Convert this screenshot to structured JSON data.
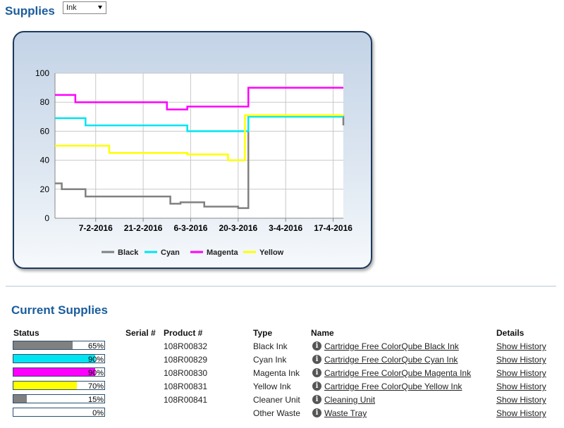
{
  "header": {
    "title": "Supplies",
    "selector_value": "Ink"
  },
  "chart_data": {
    "type": "line",
    "ylim": [
      0,
      100
    ],
    "yticks": [
      0,
      20,
      40,
      60,
      80,
      100
    ],
    "xlim": [
      "2016-01-26",
      "2016-04-20"
    ],
    "xticks": [
      "7-2-2016",
      "21-2-2016",
      "6-3-2016",
      "20-3-2016",
      "3-4-2016",
      "17-4-2016"
    ],
    "xtick_dates": [
      "2016-02-07",
      "2016-02-21",
      "2016-03-06",
      "2016-03-20",
      "2016-04-03",
      "2016-04-17"
    ],
    "grid": true,
    "legend_position": "bottom",
    "series": [
      {
        "name": "Black",
        "color": "#808080",
        "step_points": [
          [
            "2016-01-26",
            24
          ],
          [
            "2016-01-28",
            20
          ],
          [
            "2016-02-04",
            15
          ],
          [
            "2016-02-29",
            10
          ],
          [
            "2016-03-03",
            11
          ],
          [
            "2016-03-10",
            8
          ],
          [
            "2016-03-20",
            7
          ],
          [
            "2016-03-23",
            70
          ],
          [
            "2016-04-19",
            70
          ],
          [
            "2016-04-20",
            64
          ]
        ]
      },
      {
        "name": "Cyan",
        "color": "#00e5f2",
        "step_points": [
          [
            "2016-01-26",
            69
          ],
          [
            "2016-02-04",
            64
          ],
          [
            "2016-03-05",
            60
          ],
          [
            "2016-03-23",
            70
          ],
          [
            "2016-04-20",
            70
          ]
        ]
      },
      {
        "name": "Magenta",
        "color": "#ff00ff",
        "step_points": [
          [
            "2016-01-26",
            85
          ],
          [
            "2016-02-01",
            80
          ],
          [
            "2016-02-28",
            75
          ],
          [
            "2016-03-05",
            77
          ],
          [
            "2016-03-23",
            90
          ],
          [
            "2016-04-20",
            90
          ]
        ]
      },
      {
        "name": "Yellow",
        "color": "#ffff00",
        "step_points": [
          [
            "2016-01-26",
            50
          ],
          [
            "2016-02-11",
            45
          ],
          [
            "2016-03-05",
            44
          ],
          [
            "2016-03-17",
            40
          ],
          [
            "2016-03-22",
            71
          ],
          [
            "2016-04-20",
            71
          ]
        ]
      }
    ]
  },
  "current": {
    "title": "Current Supplies",
    "headers": {
      "status": "Status",
      "serial": "Serial #",
      "product": "Product #",
      "type": "Type",
      "name": "Name",
      "details": "Details"
    },
    "rows": [
      {
        "pct": "65%",
        "value": 65,
        "color": "#808080",
        "product": "108R00832",
        "type": "Black Ink",
        "name": "Cartridge Free ColorQube Black Ink",
        "details": "Show History"
      },
      {
        "pct": "90%",
        "value": 90,
        "color": "#00e5f2",
        "product": "108R00829",
        "type": "Cyan Ink",
        "name": "Cartridge Free ColorQube Cyan Ink",
        "details": "Show History"
      },
      {
        "pct": "90%",
        "value": 90,
        "color": "#ff00ff",
        "product": "108R00830",
        "type": "Magenta Ink",
        "name": "Cartridge Free ColorQube Magenta Ink",
        "details": "Show History"
      },
      {
        "pct": "70%",
        "value": 70,
        "color": "#ffff00",
        "product": "108R00831",
        "type": "Yellow Ink",
        "name": "Cartridge Free ColorQube Yellow Ink",
        "details": "Show History"
      },
      {
        "pct": "15%",
        "value": 15,
        "color": "#808080",
        "product": "108R00841",
        "type": "Cleaner Unit",
        "name": "Cleaning Unit",
        "details": "Show History"
      },
      {
        "pct": "0%",
        "value": 0,
        "color": "#808080",
        "product": "",
        "type": "Other Waste",
        "name": "Waste Tray",
        "details": "Show History"
      }
    ]
  }
}
